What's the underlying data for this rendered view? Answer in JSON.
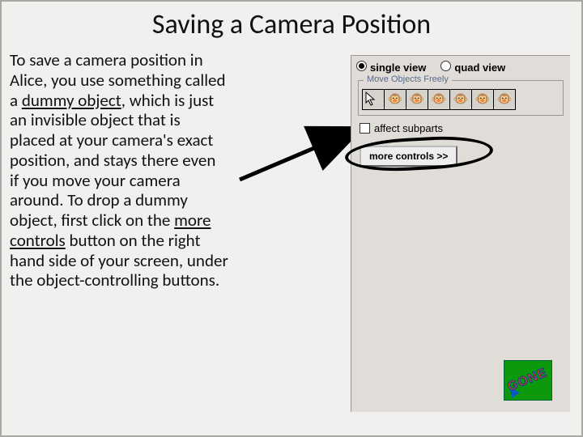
{
  "title": "Saving a Camera Position",
  "body": {
    "t1": "To save a camera position in Alice, you use something called a ",
    "t2": "dummy object",
    "t3": ", which is just an invisible object that is placed at your camera's exact position, and stays there even if you move your camera around. To drop a dummy object, first click on the ",
    "t4": "more controls",
    "t5": " button on the right hand side of your screen, under the object-controlling buttons."
  },
  "panel": {
    "single": "single view",
    "quad": "quad view",
    "group": "Move Objects Freely",
    "affect": "affect subparts",
    "more": "more controls  >>"
  },
  "gone": "GONE"
}
